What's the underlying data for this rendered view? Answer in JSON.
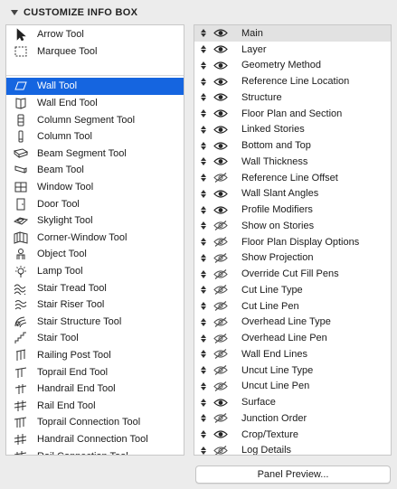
{
  "header": {
    "title": "CUSTOMIZE INFO BOX"
  },
  "tools_top": [
    {
      "label": "Arrow Tool",
      "icon": "arrow-icon"
    },
    {
      "label": "Marquee Tool",
      "icon": "marquee-icon"
    }
  ],
  "tools": [
    {
      "label": "Wall Tool",
      "icon": "wall-icon",
      "selected": true
    },
    {
      "label": "Wall End Tool",
      "icon": "wall-end-icon"
    },
    {
      "label": "Column Segment Tool",
      "icon": "column-segment-icon"
    },
    {
      "label": "Column Tool",
      "icon": "column-icon"
    },
    {
      "label": "Beam Segment Tool",
      "icon": "beam-segment-icon"
    },
    {
      "label": "Beam Tool",
      "icon": "beam-icon"
    },
    {
      "label": "Window Tool",
      "icon": "window-icon"
    },
    {
      "label": "Door Tool",
      "icon": "door-icon"
    },
    {
      "label": "Skylight Tool",
      "icon": "skylight-icon"
    },
    {
      "label": "Corner-Window Tool",
      "icon": "corner-window-icon"
    },
    {
      "label": "Object Tool",
      "icon": "object-icon"
    },
    {
      "label": "Lamp Tool",
      "icon": "lamp-icon"
    },
    {
      "label": "Stair Tread Tool",
      "icon": "stair-tread-icon"
    },
    {
      "label": "Stair Riser Tool",
      "icon": "stair-riser-icon"
    },
    {
      "label": "Stair Structure Tool",
      "icon": "stair-structure-icon"
    },
    {
      "label": "Stair Tool",
      "icon": "stair-icon"
    },
    {
      "label": "Railing Post Tool",
      "icon": "railing-post-icon"
    },
    {
      "label": "Toprail End Tool",
      "icon": "toprail-end-icon"
    },
    {
      "label": "Handrail End Tool",
      "icon": "handrail-end-icon"
    },
    {
      "label": "Rail End Tool",
      "icon": "rail-end-icon"
    },
    {
      "label": "Toprail Connection Tool",
      "icon": "toprail-connection-icon"
    },
    {
      "label": "Handrail Connection Tool",
      "icon": "handrail-connection-icon"
    },
    {
      "label": "Rail Connection Tool",
      "icon": "rail-connection-icon"
    }
  ],
  "info_items": [
    {
      "label": "Main",
      "visible": true,
      "highlight": true
    },
    {
      "label": "Layer",
      "visible": true
    },
    {
      "label": "Geometry Method",
      "visible": true
    },
    {
      "label": "Reference Line Location",
      "visible": true
    },
    {
      "label": "Structure",
      "visible": true
    },
    {
      "label": "Floor Plan and Section",
      "visible": true
    },
    {
      "label": "Linked Stories",
      "visible": true
    },
    {
      "label": "Bottom and Top",
      "visible": true
    },
    {
      "label": "Wall Thickness",
      "visible": true
    },
    {
      "label": "Reference Line Offset",
      "visible": false
    },
    {
      "label": "Wall Slant Angles",
      "visible": true
    },
    {
      "label": "Profile Modifiers",
      "visible": true
    },
    {
      "label": "Show on Stories",
      "visible": false
    },
    {
      "label": "Floor Plan Display Options",
      "visible": false
    },
    {
      "label": "Show Projection",
      "visible": false
    },
    {
      "label": "Override Cut Fill Pens",
      "visible": false
    },
    {
      "label": "Cut Line Type",
      "visible": false
    },
    {
      "label": "Cut Line Pen",
      "visible": false
    },
    {
      "label": "Overhead Line Type",
      "visible": false
    },
    {
      "label": "Overhead Line Pen",
      "visible": false
    },
    {
      "label": "Wall End Lines",
      "visible": false
    },
    {
      "label": "Uncut Line Type",
      "visible": false
    },
    {
      "label": "Uncut Line Pen",
      "visible": false
    },
    {
      "label": "Surface",
      "visible": true
    },
    {
      "label": "Junction Order",
      "visible": false
    },
    {
      "label": "Crop/Texture",
      "visible": true
    },
    {
      "label": "Log Details",
      "visible": false
    }
  ],
  "footer": {
    "preview_label": "Panel Preview..."
  },
  "colors": {
    "selection": "#1565e0",
    "highlight": "#e2e2e2"
  }
}
